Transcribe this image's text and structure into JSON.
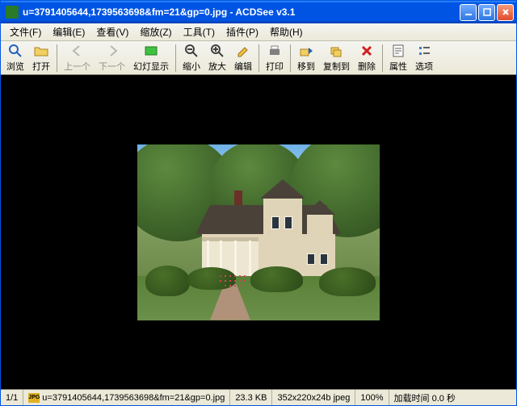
{
  "titlebar": {
    "text": "u=3791405644,1739563698&fm=21&gp=0.jpg - ACDSee v3.1"
  },
  "menu": {
    "file": "文件(F)",
    "edit": "编辑(E)",
    "view": "查看(V)",
    "zoom": "缩放(Z)",
    "tools": "工具(T)",
    "plugins": "插件(P)",
    "help": "帮助(H)"
  },
  "toolbar": {
    "browse": "浏览",
    "open": "打开",
    "prev": "上一个",
    "next": "下一个",
    "slideshow": "幻灯显示",
    "zoomout": "缩小",
    "zoomin": "放大",
    "editimg": "编辑",
    "print": "打印",
    "moveto": "移到",
    "copyto": "复制到",
    "delete": "删除",
    "properties": "属性",
    "options": "选项"
  },
  "status": {
    "position": "1/1",
    "filename": "u=3791405644,1739563698&fm=21&gp=0.jpg",
    "filesize": "23.3 KB",
    "dimensions": "352x220x24b jpeg",
    "zoom": "100%",
    "loadtime": "加载时间 0.0 秒"
  }
}
